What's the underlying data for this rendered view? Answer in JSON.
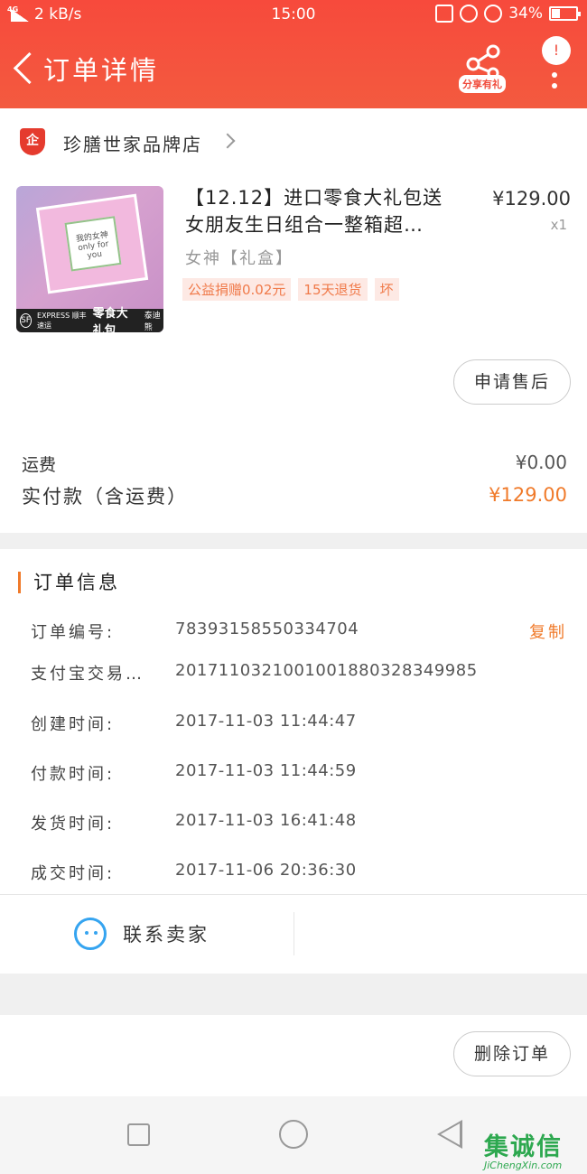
{
  "status_bar": {
    "network": "4G",
    "speed": "2 kB/s",
    "time": "15:00",
    "battery": "34%",
    "battery_level": 0.34
  },
  "header": {
    "title": "订单详情",
    "share_label": "分享有礼",
    "badge": "!",
    "bg_color": "#f4503d"
  },
  "store": {
    "name": "珍膳世家品牌店",
    "icon_label": "企"
  },
  "product": {
    "image_card_text": "我的女神 only for you",
    "image_strip_logo": "SF",
    "image_strip_express": "EXPRESS 顺丰速运",
    "image_strip_title": "零食大礼包",
    "image_strip_brand": "泰迪熊",
    "title_line1": "【12.12】进口零食大礼包送",
    "title_line2": "女朋友生日组合一整箱超…",
    "price": "¥129.00",
    "quantity": "x1",
    "sku": "女神【礼盒】",
    "tags": [
      "公益捐赠0.02元",
      "15天退货",
      "坏"
    ]
  },
  "actions": {
    "after_sale": "申请售后",
    "delete_order": "删除订单"
  },
  "summary": {
    "shipping_label": "运费",
    "shipping_value": "¥0.00",
    "total_label": "实付款（含运费）",
    "total_value": "¥129.00"
  },
  "order_info": {
    "heading": "订单信息",
    "copy_label": "复制",
    "rows": [
      {
        "label": "订单编号:",
        "value": "78393158550334704"
      },
      {
        "label": "支付宝交易…",
        "value": "2017110321001001880328349985"
      },
      {
        "label": "创建时间:",
        "value": "2017-11-03 11:44:47"
      },
      {
        "label": "付款时间:",
        "value": "2017-11-03 11:44:59"
      },
      {
        "label": "发货时间:",
        "value": "2017-11-03 16:41:48"
      },
      {
        "label": "成交时间:",
        "value": "2017-11-06 20:36:30"
      }
    ],
    "contact_seller": "联系卖家"
  },
  "watermark": {
    "glyphs": "集诚信",
    "site": "JiChengXin.com"
  },
  "colors": {
    "accent": "#f07a2a",
    "header": "#f4503d",
    "contact_icon": "#35a4f0"
  }
}
